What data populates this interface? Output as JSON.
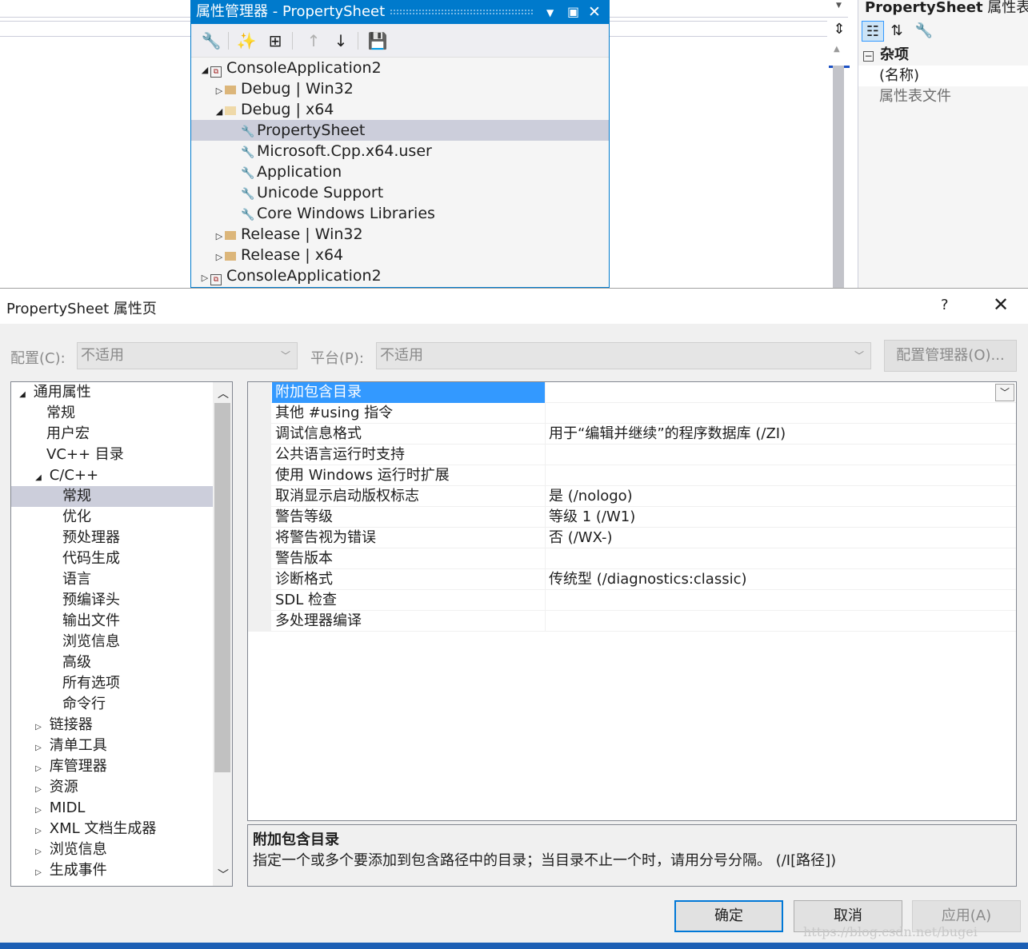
{
  "property_manager": {
    "title": "属性管理器 - PropertySheet",
    "tree": [
      {
        "label": "ConsoleApplication2",
        "level": 0,
        "expanded": true,
        "kind": "project"
      },
      {
        "label": "Debug | Win32",
        "level": 1,
        "expanded": false,
        "kind": "folder"
      },
      {
        "label": "Debug | x64",
        "level": 1,
        "expanded": true,
        "kind": "folder"
      },
      {
        "label": "PropertySheet",
        "level": 2,
        "kind": "sheet",
        "selected": true
      },
      {
        "label": "Microsoft.Cpp.x64.user",
        "level": 2,
        "kind": "sheet"
      },
      {
        "label": "Application",
        "level": 2,
        "kind": "sheet"
      },
      {
        "label": "Unicode Support",
        "level": 2,
        "kind": "sheet"
      },
      {
        "label": "Core Windows Libraries",
        "level": 2,
        "kind": "sheet"
      },
      {
        "label": "Release | Win32",
        "level": 1,
        "expanded": false,
        "kind": "folder"
      },
      {
        "label": "Release | x64",
        "level": 1,
        "expanded": false,
        "kind": "folder"
      },
      {
        "label": "ConsoleApplication2",
        "level": 0,
        "expanded": false,
        "kind": "project"
      }
    ]
  },
  "properties_panel": {
    "title_bold": "PropertySheet",
    "title_rest": " 属性表属",
    "category": "杂项",
    "rows": [
      {
        "label": "(名称)",
        "gray": false
      },
      {
        "label": "属性表文件",
        "gray": true
      }
    ]
  },
  "dialog": {
    "title": "PropertySheet 属性页",
    "help": "?",
    "close": "✕",
    "config_label": "配置(C):",
    "config_value": "不适用",
    "platform_label": "平台(P):",
    "platform_value": "不适用",
    "config_manager": "配置管理器(O)...",
    "nav": [
      {
        "label": "通用属性",
        "level": 0,
        "tri": "open"
      },
      {
        "label": "常规",
        "level": 1,
        "tri": "none"
      },
      {
        "label": "用户宏",
        "level": 1,
        "tri": "none"
      },
      {
        "label": "VC++ 目录",
        "level": 1,
        "tri": "none"
      },
      {
        "label": "C/C++",
        "level": 1,
        "tri": "open"
      },
      {
        "label": "常规",
        "level": 2,
        "tri": "none",
        "selected": true
      },
      {
        "label": "优化",
        "level": 2,
        "tri": "none"
      },
      {
        "label": "预处理器",
        "level": 2,
        "tri": "none"
      },
      {
        "label": "代码生成",
        "level": 2,
        "tri": "none"
      },
      {
        "label": "语言",
        "level": 2,
        "tri": "none"
      },
      {
        "label": "预编译头",
        "level": 2,
        "tri": "none"
      },
      {
        "label": "输出文件",
        "level": 2,
        "tri": "none"
      },
      {
        "label": "浏览信息",
        "level": 2,
        "tri": "none"
      },
      {
        "label": "高级",
        "level": 2,
        "tri": "none"
      },
      {
        "label": "所有选项",
        "level": 2,
        "tri": "none"
      },
      {
        "label": "命令行",
        "level": 2,
        "tri": "none"
      },
      {
        "label": "链接器",
        "level": 1,
        "tri": "closed"
      },
      {
        "label": "清单工具",
        "level": 1,
        "tri": "closed"
      },
      {
        "label": "库管理器",
        "level": 1,
        "tri": "closed"
      },
      {
        "label": "资源",
        "level": 1,
        "tri": "closed"
      },
      {
        "label": "MIDL",
        "level": 1,
        "tri": "closed"
      },
      {
        "label": "XML 文档生成器",
        "level": 1,
        "tri": "closed"
      },
      {
        "label": "浏览信息",
        "level": 1,
        "tri": "closed"
      },
      {
        "label": "生成事件",
        "level": 1,
        "tri": "closed"
      }
    ],
    "grid": [
      {
        "name": "附加包含目录",
        "value": "",
        "selected": true
      },
      {
        "name": "其他 #using 指令",
        "value": ""
      },
      {
        "name": "调试信息格式",
        "value": "用于“编辑并继续”的程序数据库 (/ZI)"
      },
      {
        "name": "公共语言运行时支持",
        "value": ""
      },
      {
        "name": "使用 Windows 运行时扩展",
        "value": ""
      },
      {
        "name": "取消显示启动版权标志",
        "value": "是 (/nologo)"
      },
      {
        "name": "警告等级",
        "value": "等级 1 (/W1)"
      },
      {
        "name": "将警告视为错误",
        "value": "否 (/WX-)"
      },
      {
        "name": "警告版本",
        "value": ""
      },
      {
        "name": "诊断格式",
        "value": "传统型 (/diagnostics:classic)"
      },
      {
        "name": "SDL 检查",
        "value": ""
      },
      {
        "name": "多处理器编译",
        "value": ""
      }
    ],
    "desc_title": "附加包含目录",
    "desc_text": "指定一个或多个要添加到包含路径中的目录；当目录不止一个时，请用分号分隔。     (/I[路径])",
    "ok": "确定",
    "cancel": "取消",
    "apply": "应用(A)"
  },
  "watermark": "https://blog.csdn.net/bugei",
  "colors": {
    "accent": "#007acc",
    "selection": "#3399ff",
    "tree_selection": "#cccedb"
  }
}
